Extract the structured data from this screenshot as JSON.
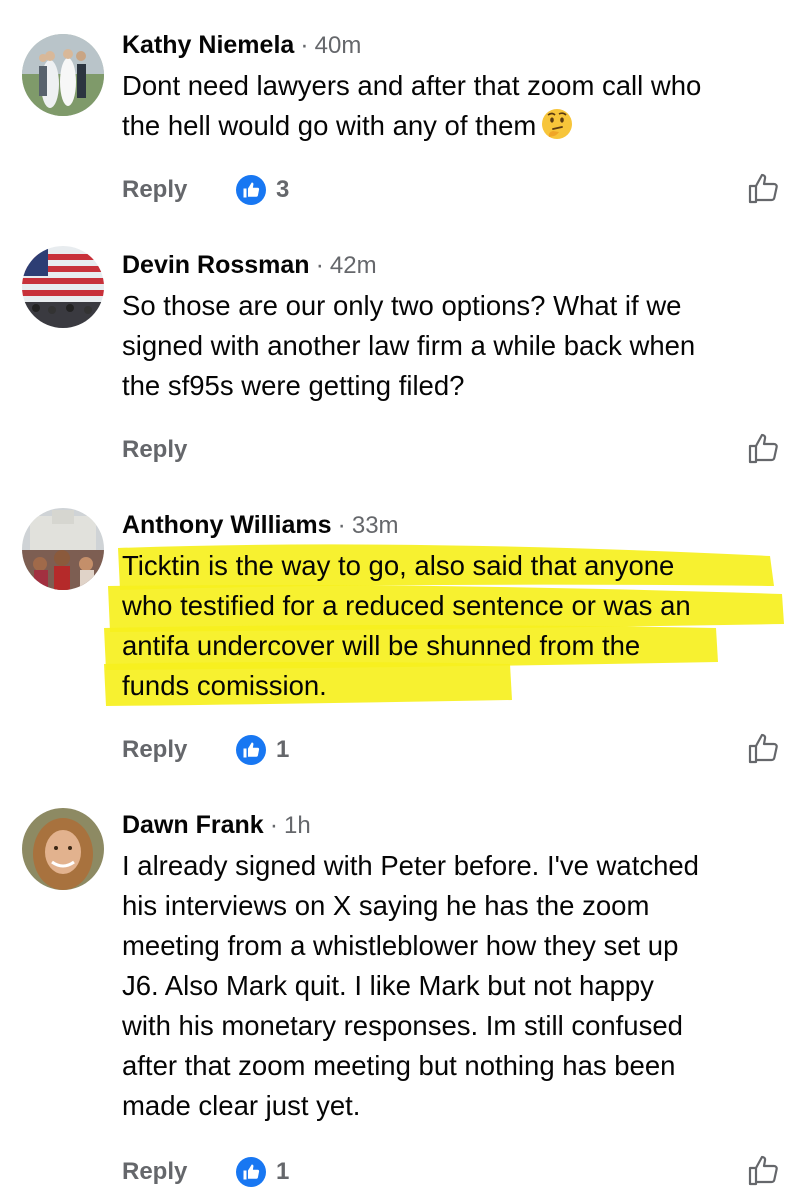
{
  "comments": [
    {
      "author": "Kathy Niemela",
      "time": "40m",
      "text_lines": [
        "Dont need lawyers and after that zoom call who",
        "the hell would go with any of them"
      ],
      "emoji": "thinking-face",
      "reply_label": "Reply",
      "reactions": "3"
    },
    {
      "author": "Devin Rossman",
      "time": "42m",
      "text_lines": [
        "So those are our only two options? What if we",
        "signed with another law firm a while back when",
        "the sf95s were getting filed?"
      ],
      "reply_label": "Reply",
      "reactions": ""
    },
    {
      "author": "Anthony Williams",
      "time": "33m",
      "text_lines": [
        "Ticktin is the way to go, also said that anyone",
        "who testified for a reduced sentence or was an",
        "antifa undercover will be shunned from the",
        "funds comission."
      ],
      "highlighted": true,
      "reply_label": "Reply",
      "reactions": "1"
    },
    {
      "author": "Dawn Frank",
      "time": "1h",
      "text_lines": [
        "I already signed with Peter before. I've watched",
        "his interviews on X saying he has the zoom",
        "meeting from a whistleblower how they set up",
        "J6. Also Mark quit. I like Mark but not happy",
        "with his monetary responses. Im still confused",
        "after that zoom meeting but nothing has been",
        "made clear just yet."
      ],
      "reply_label": "Reply",
      "reactions": "1"
    }
  ],
  "colors": {
    "like_blue": "#1877f2",
    "meta_gray": "#65676b",
    "highlight": "#f6f01e"
  }
}
